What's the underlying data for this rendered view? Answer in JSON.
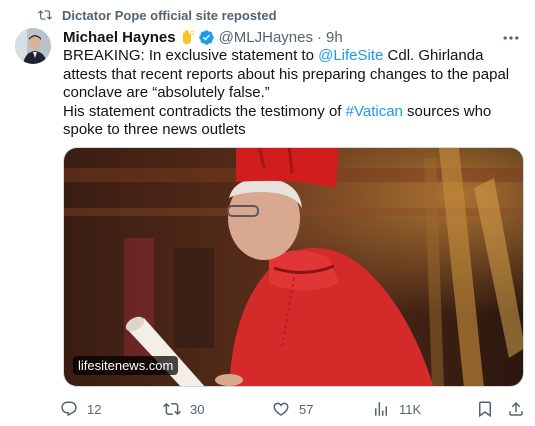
{
  "repost": {
    "text": "Dictator Pope official site reposted",
    "icon": "repost-icon"
  },
  "author": {
    "name": "Michael Haynes",
    "emoji": "hand-emoji",
    "handle": "@MLJHaynes",
    "separator": "·",
    "time": "9h"
  },
  "tweet": {
    "line1_a": "BREAKING: In exclusive statement to ",
    "mention": "@LifeSite",
    "line1_b": " Cdl. Ghirlanda attests that recent reports about his preparing changes to the papal conclave are “absolutely false.”",
    "line2_a": "His statement contradicts the testimony of ",
    "hashtag": "#Vatican",
    "line2_b": " sources who spoke to three news outlets"
  },
  "media": {
    "badge": "lifesitenews.com"
  },
  "actions": {
    "replies": "12",
    "reposts": "30",
    "likes": "57",
    "views": "11K"
  },
  "colors": {
    "link": "#1d9bf0",
    "muted": "#536471",
    "text": "#0f1419",
    "verified": "#1d9bf0"
  }
}
